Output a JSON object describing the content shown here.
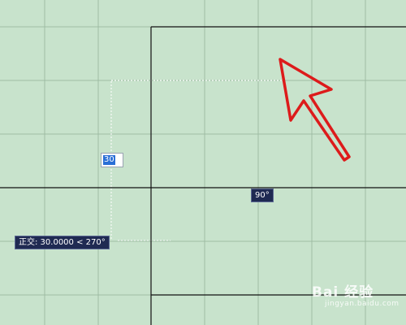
{
  "drawing_area": {
    "background_color": "#c8e3cc",
    "grid_color": "#9fbca4",
    "line_color": "#111111",
    "arrow_color": "#dd1b1b"
  },
  "dynamic_input": {
    "value": "30"
  },
  "polar_tooltip": {
    "text": "90°"
  },
  "ortho_tooltip": {
    "text": "正交: 30.0000 < 270°"
  },
  "watermark": {
    "text": "Bai 经验",
    "sub": "jingyan.baidu.com"
  }
}
